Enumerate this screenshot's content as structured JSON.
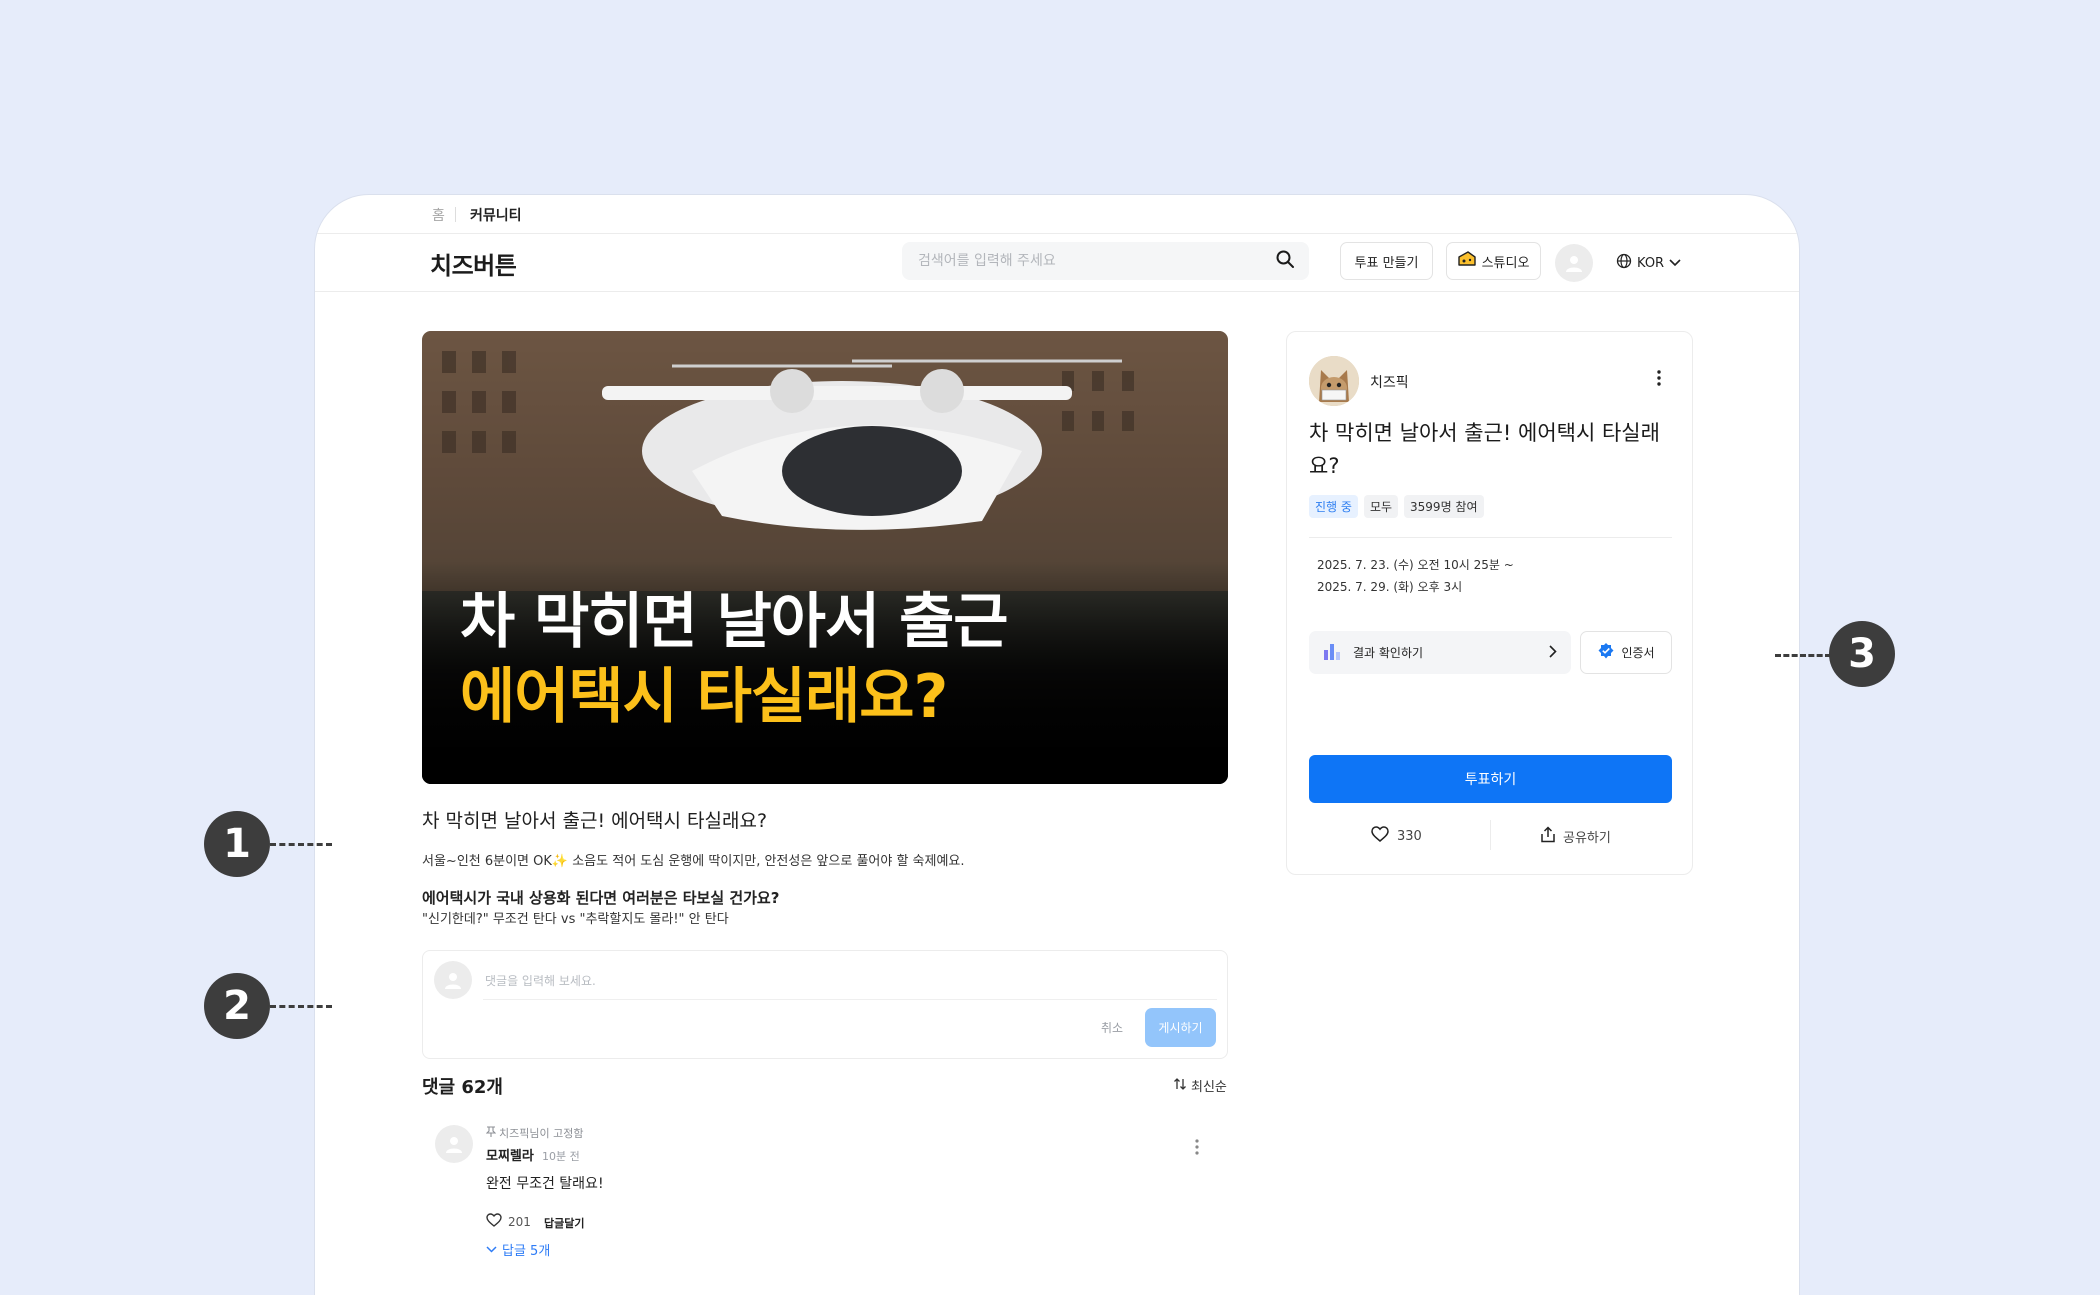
{
  "breadcrumb": {
    "home": "홈",
    "current": "커뮤니티"
  },
  "header": {
    "logo": "치즈버튼",
    "search_placeholder": "검색어를 입력해 주세요",
    "make_poll": "투표 만들기",
    "studio": "스튜디오",
    "language": "KOR"
  },
  "hero": {
    "line1": "차 막히면 날아서 출근",
    "line2": "에어택시 타실래요?"
  },
  "post": {
    "title": "차 막히면 날아서 출근! 에어택시 타실래요?",
    "body": "서울~인천 6분이면 OK✨ 소음도 적어 도심 운행에 딱이지만, 안전성은 앞으로 풀어야 할 숙제예요.",
    "question": "에어택시가 국내 상용화 된다면 여러분은 타보실 건가요?",
    "options_line": "\"신기한데?\" 무조건 탄다 vs \"추락할지도 몰라!\" 안 탄다"
  },
  "comment_box": {
    "placeholder": "댓글을 입력해 보세요.",
    "cancel": "취소",
    "submit": "게시하기"
  },
  "comments": {
    "count_label": "댓글 62개",
    "sort": "최신순",
    "items": [
      {
        "pinned": "치즈픽님이 고정함",
        "author": "모찌렐라",
        "time": "10분 전",
        "text": "완전 무조건 탈래요!",
        "likes": "201",
        "reply_label": "답글달기",
        "replies_label": "답글 5개"
      }
    ]
  },
  "card": {
    "author": "치즈픽",
    "title": "차 막히면 날아서 출근! 에어택시 타실래요?",
    "tags": [
      "진행 중",
      "모두",
      "3599명 참여"
    ],
    "date_start": "2025. 7. 23. (수) 오전 10시 25분 ~",
    "date_end": "2025. 7. 29. (화) 오후 3시",
    "result_button": "결과 확인하기",
    "cert_button": "인증서",
    "vote_button": "투표하기",
    "likes": "330",
    "share": "공유하기"
  },
  "markers": [
    "1",
    "2",
    "3"
  ],
  "colors": {
    "accent": "#0e75f6",
    "hero_highlight": "#fcc01a",
    "live_tag": "#2f7ff1"
  }
}
